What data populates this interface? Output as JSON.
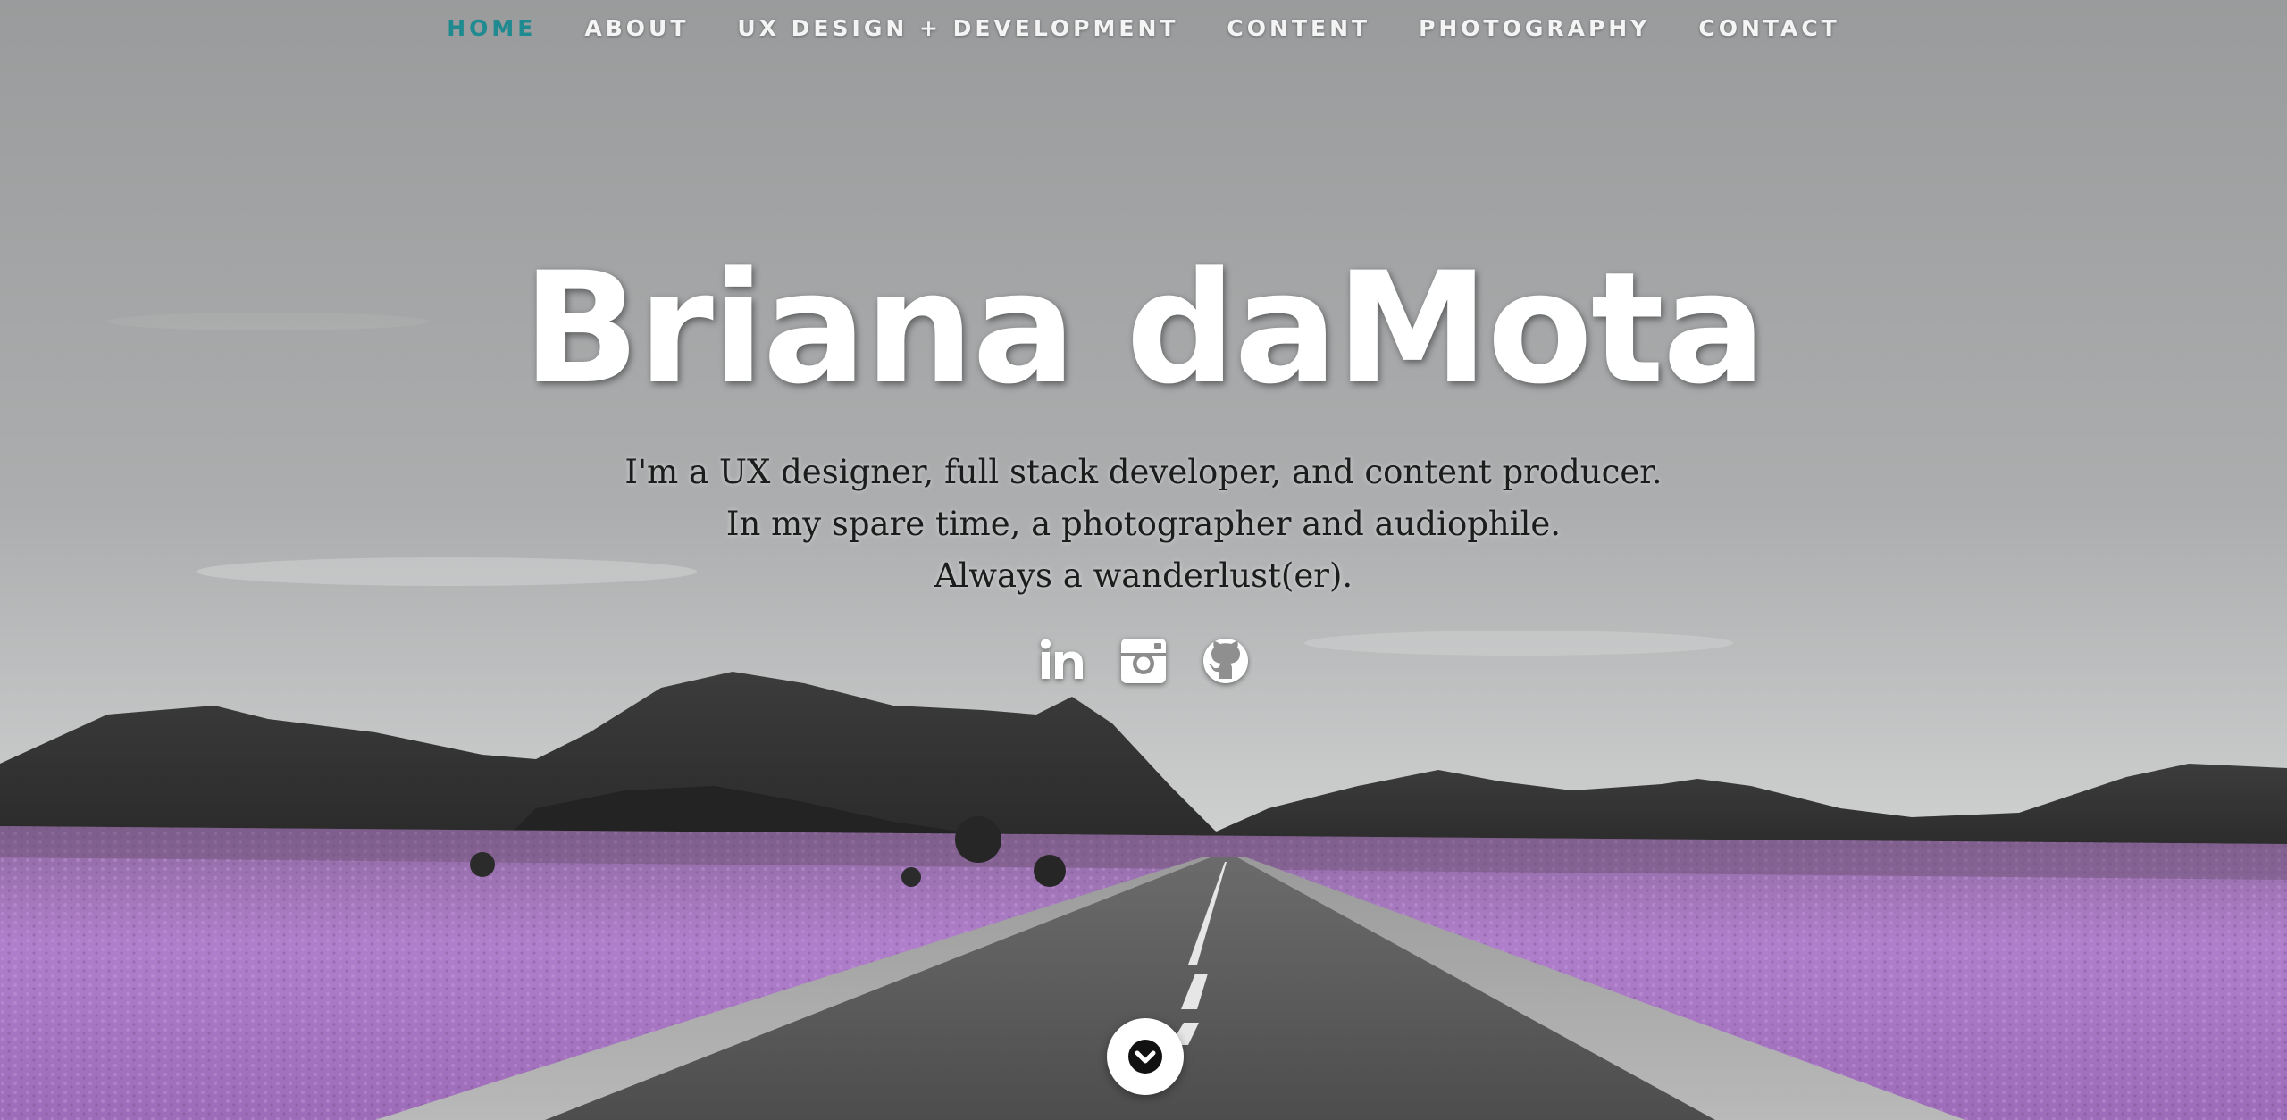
{
  "nav": {
    "items": [
      {
        "label": "HOME",
        "active": true
      },
      {
        "label": "ABOUT"
      },
      {
        "label": "UX DESIGN + DEVELOPMENT"
      },
      {
        "label": "CONTENT"
      },
      {
        "label": "PHOTOGRAPHY"
      },
      {
        "label": "CONTACT"
      }
    ]
  },
  "hero": {
    "name": "Briana daMota",
    "tagline": [
      "I'm a UX designer, full stack developer, and content producer.",
      "In my spare time, a photographer and audiophile.",
      "Always a wanderlust(er)."
    ],
    "socials": [
      {
        "name": "linkedin-icon"
      },
      {
        "name": "instagram-icon"
      },
      {
        "name": "github-icon"
      }
    ],
    "scroll_icon": "chevron-down-icon"
  },
  "colors": {
    "accent": "#1f8a8f",
    "nav_text": "#f4f4f4",
    "flowers": "#b77fd0",
    "sky": "#9a9c9d"
  }
}
